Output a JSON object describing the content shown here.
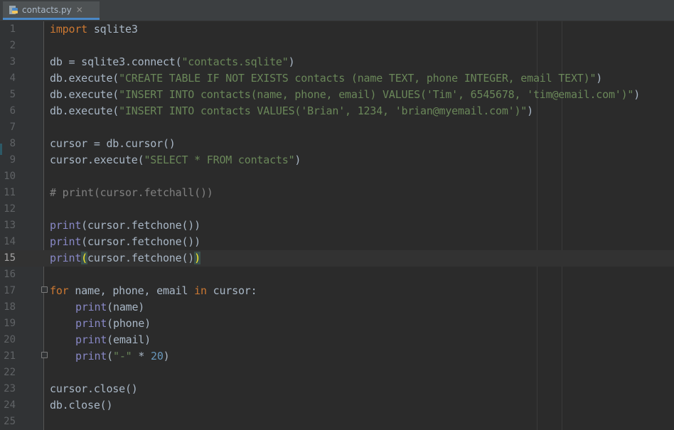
{
  "tab": {
    "label": "contacts.py",
    "close": "✕"
  },
  "lines": [
    {
      "n": "1"
    },
    {
      "n": "2"
    },
    {
      "n": "3"
    },
    {
      "n": "4"
    },
    {
      "n": "5"
    },
    {
      "n": "6"
    },
    {
      "n": "7"
    },
    {
      "n": "8"
    },
    {
      "n": "9"
    },
    {
      "n": "10"
    },
    {
      "n": "11"
    },
    {
      "n": "12"
    },
    {
      "n": "13"
    },
    {
      "n": "14"
    },
    {
      "n": "15"
    },
    {
      "n": "16"
    },
    {
      "n": "17"
    },
    {
      "n": "18"
    },
    {
      "n": "19"
    },
    {
      "n": "20"
    },
    {
      "n": "21"
    },
    {
      "n": "22"
    },
    {
      "n": "23"
    },
    {
      "n": "24"
    },
    {
      "n": "25"
    }
  ],
  "code": {
    "l1_kw": "import",
    "l1_rest": " sqlite3",
    "l3_a": "db = sqlite3.connect(",
    "l3_s": "\"contacts.sqlite\"",
    "l3_b": ")",
    "l4_a": "db.execute(",
    "l4_s": "\"CREATE TABLE IF NOT EXISTS contacts (name TEXT, phone INTEGER, email TEXT)\"",
    "l4_b": ")",
    "l5_a": "db.execute(",
    "l5_s": "\"INSERT INTO contacts(name, phone, email) VALUES('Tim', 6545678, 'tim@email.com')\"",
    "l5_b": ")",
    "l6_a": "db.execute(",
    "l6_s": "\"INSERT INTO contacts VALUES('Brian', 1234, 'brian@myemail.com')\"",
    "l6_b": ")",
    "l8": "cursor = db.cursor()",
    "l9_a": "cursor.execute(",
    "l9_s": "\"SELECT * FROM contacts\"",
    "l9_b": ")",
    "l11": "# print(cursor.fetchall())",
    "print": "print",
    "l13_rest": "(cursor.fetchone())",
    "l15_open": "(",
    "l15_mid": "cursor.fetchone()",
    "l15_close": ")",
    "l17_for": "for",
    "l17_mid": " name, phone, email ",
    "l17_in": "in",
    "l17_end": " cursor:",
    "l18_rest": "(name)",
    "l19_rest": "(phone)",
    "l20_rest": "(email)",
    "l21_a": "(",
    "l21_s": "\"-\"",
    "l21_mid": " * ",
    "l21_n": "20",
    "l21_b": ")",
    "l23": "cursor.close()",
    "l24": "db.close()"
  },
  "colors": {
    "keyword": "#cc7832",
    "string": "#6a8759",
    "builtin": "#8888c6",
    "number": "#6897bb",
    "comment": "#808080",
    "default": "#a9b7c6",
    "background": "#2b2b2b",
    "gutter": "#313335",
    "current_line": "#323232"
  },
  "icons": {
    "file": "python-file-icon"
  }
}
